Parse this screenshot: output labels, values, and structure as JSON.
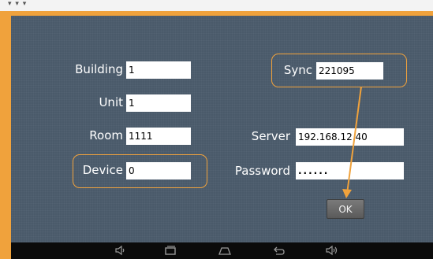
{
  "form": {
    "building": {
      "label": "Building",
      "value": "1"
    },
    "unit": {
      "label": "Unit",
      "value": "1"
    },
    "room": {
      "label": "Room",
      "value": "1111"
    },
    "device": {
      "label": "Device",
      "value": "0"
    },
    "sync": {
      "label": "Sync",
      "value": "221095"
    },
    "server": {
      "label": "Server",
      "value": "192.168.12.40"
    },
    "password": {
      "label": "Password",
      "value": "......"
    },
    "ok_label": "OK"
  },
  "navbar": {
    "icons": [
      "volume-down-icon",
      "recent-apps-icon",
      "home-icon",
      "back-icon",
      "volume-up-icon"
    ]
  },
  "colors": {
    "highlight": "#f0a23c",
    "screen_bg": "#4a5a6a",
    "navbar_bg": "#0b0b0b"
  }
}
